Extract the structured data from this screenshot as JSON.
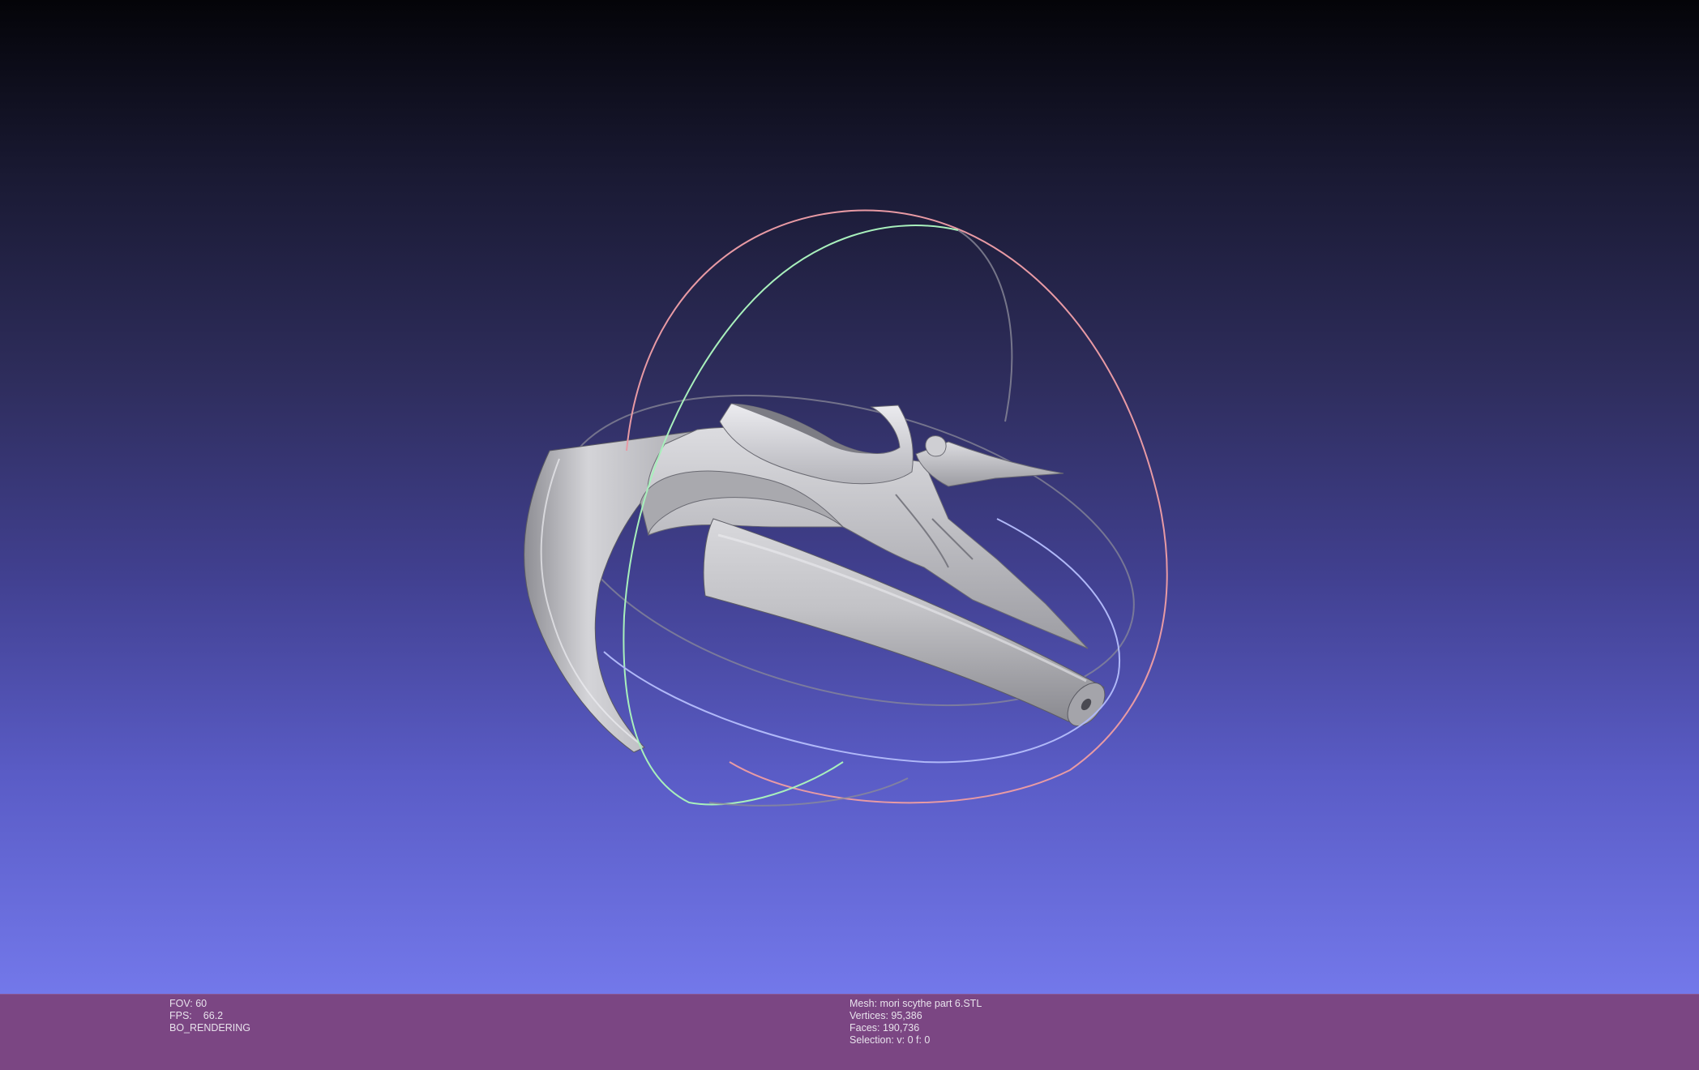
{
  "render_info": {
    "fov_label": "FOV:",
    "fov_value": "60",
    "fps_label": "FPS:",
    "fps_value": "66.2",
    "render_mode": "BO_RENDERING"
  },
  "mesh_info": {
    "mesh_label": "Mesh:",
    "mesh_name": "mori scythe part 6.STL",
    "vertices_label": "Vertices:",
    "vertices_value": "95,386",
    "faces_label": "Faces:",
    "faces_value": "190,736",
    "selection_label": "Selection:",
    "selection_value": "v: 0 f: 0"
  },
  "colors": {
    "background_top": "#040408",
    "background_bottom": "#7378ea",
    "info_bar": "#7b4683",
    "mesh_surface": "#c4c4c8",
    "trackball_x": "#e89aa4",
    "trackball_y": "#a8f0bc",
    "trackball_z": "#b0b8f8"
  },
  "viewport": {
    "object": "3d-mesh-scythe-part",
    "trackball": "trackball-gizmo"
  }
}
